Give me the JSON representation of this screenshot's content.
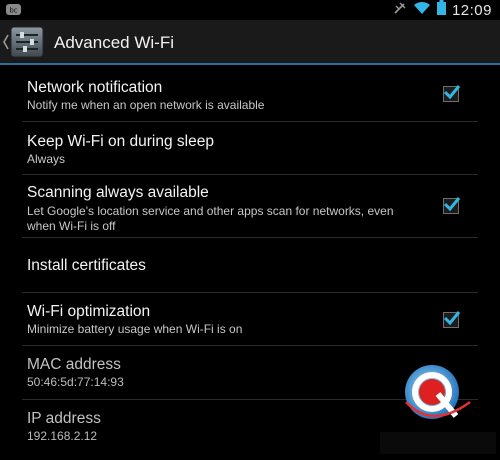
{
  "status_bar": {
    "time": "12:09",
    "icons": [
      "notification-icon",
      "vibrate-icon",
      "wifi-icon",
      "battery-icon"
    ]
  },
  "action_bar": {
    "title": "Advanced Wi-Fi",
    "icon": "settings-sliders-icon"
  },
  "preferences": [
    {
      "title": "Network notification",
      "summary": "Notify me when an open network is available",
      "checkbox": true,
      "checked": true
    },
    {
      "title": "Keep Wi-Fi on during sleep",
      "summary": "Always",
      "checkbox": false
    },
    {
      "title": "Scanning always available",
      "summary": "Let Google's location service and other apps scan for networks, even when Wi-Fi is off",
      "checkbox": true,
      "checked": true
    },
    {
      "title": "Install certificates",
      "summary": "",
      "checkbox": false
    },
    {
      "title": "Wi-Fi optimization",
      "summary": "Minimize battery usage when Wi-Fi is on",
      "checkbox": true,
      "checked": true
    },
    {
      "title": "MAC address",
      "summary": "50:46:5d:77:14:93",
      "checkbox": false,
      "disabled": true
    },
    {
      "title": "IP address",
      "summary": "192.168.2.12",
      "checkbox": false,
      "disabled": true
    }
  ],
  "watermark": {
    "text": "驱动中国"
  },
  "colors": {
    "accent": "#33b5e5",
    "divider": "#2a2a2a",
    "action_bar_underline": "#2d6f9c"
  }
}
